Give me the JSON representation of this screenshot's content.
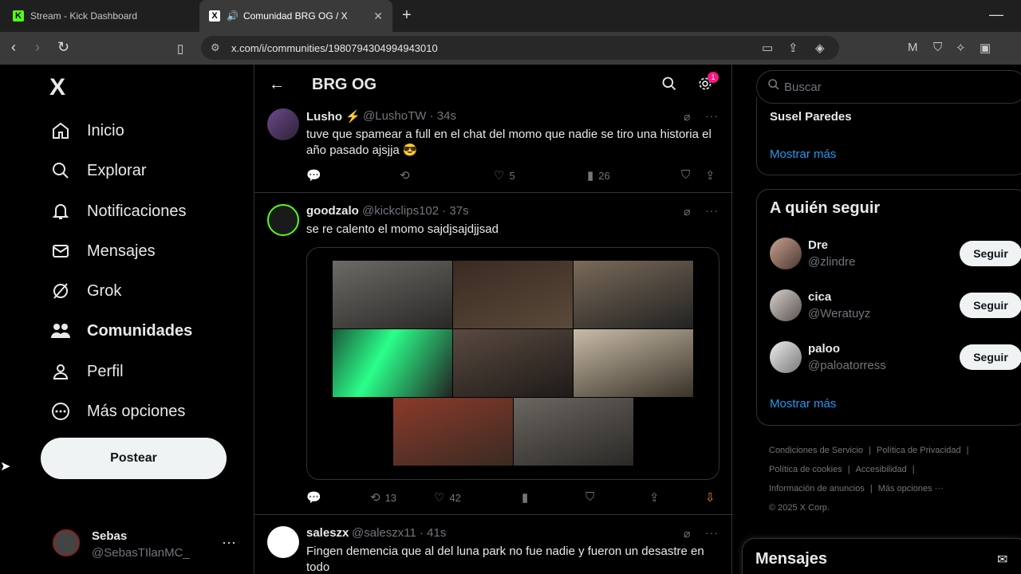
{
  "browser": {
    "tabs": [
      {
        "title": "Stream - Kick Dashboard",
        "favicon": "K"
      },
      {
        "title": "Comunidad BRG OG / X",
        "favicon": "X"
      }
    ],
    "url": "x.com/i/communities/1980794304994943010"
  },
  "sidebar": {
    "logo": "X",
    "items": [
      {
        "label": "Inicio",
        "icon": "home-icon"
      },
      {
        "label": "Explorar",
        "icon": "search-icon"
      },
      {
        "label": "Notificaciones",
        "icon": "bell-icon"
      },
      {
        "label": "Mensajes",
        "icon": "mail-icon"
      },
      {
        "label": "Grok",
        "icon": "grok-icon"
      },
      {
        "label": "Comunidades",
        "icon": "communities-icon"
      },
      {
        "label": "Perfil",
        "icon": "person-icon"
      },
      {
        "label": "Más opciones",
        "icon": "more-circle-icon"
      }
    ],
    "post_label": "Postear",
    "account": {
      "name": "Sebas",
      "handle": "@SebasTIlanMC_"
    }
  },
  "community": {
    "title": "BRG OG",
    "badge_count": "1"
  },
  "tweets": [
    {
      "name": "Lusho",
      "handle": "@LushoTW",
      "time": "· 34s",
      "text": "tuve que spamear a full en el chat del momo que nadie se tiro una historia el año pasado ajsjja 😎",
      "likes": "5",
      "views": "26"
    },
    {
      "name": "goodzalo",
      "handle": "@kickclips102",
      "time": "· 37s",
      "text": "se re calento el momo sajdjsajdjjsad",
      "reposts": "13",
      "likes": "42"
    },
    {
      "name": "saleszx",
      "handle": "@saleszx11",
      "time": "· 41s",
      "text": "Fingen demencia que al del luna park no fue nadie y fueron un desastre en todo"
    }
  ],
  "right": {
    "search_placeholder": "Buscar",
    "trend_name": "Susel Paredes",
    "show_more": "Mostrar más",
    "follow_title": "A quién seguir",
    "follow": [
      {
        "name": "Dre",
        "handle": "@zlindre",
        "button": "Seguir"
      },
      {
        "name": "cica",
        "handle": "@Weratuyz",
        "button": "Seguir"
      },
      {
        "name": "paloo",
        "handle": "@paloatorress",
        "button": "Seguir"
      }
    ],
    "footer": {
      "terms": "Condiciones de Servicio",
      "privacy": "Política de Privacidad",
      "cookies": "Política de cookies",
      "accessibility": "Accesibilidad",
      "ads": "Información de anuncios",
      "more": "Más opciones ···",
      "copyright": "© 2025 X Corp."
    },
    "messages_title": "Mensajes"
  }
}
